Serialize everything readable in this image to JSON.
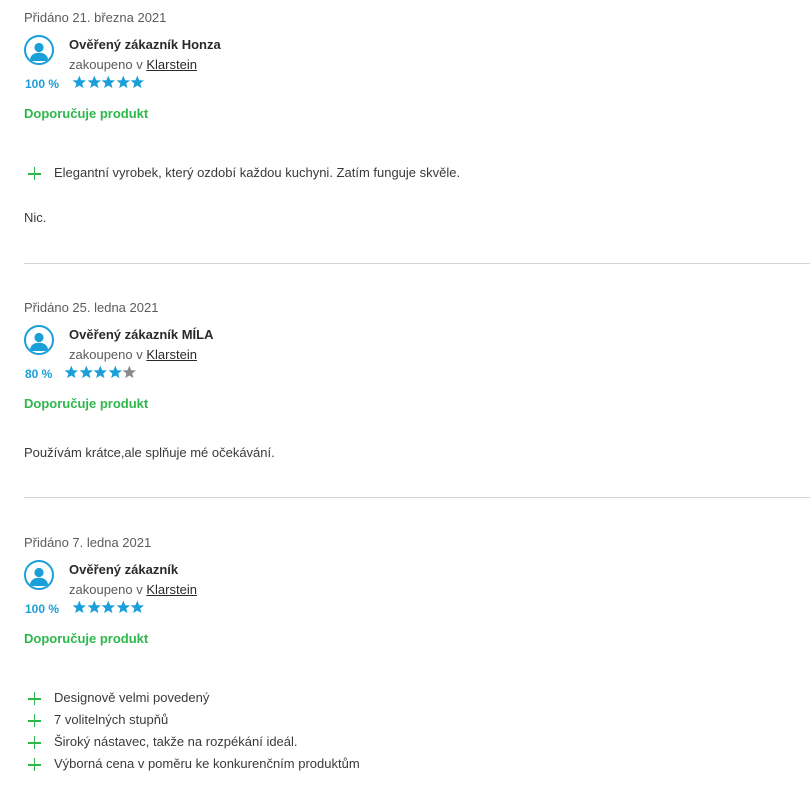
{
  "reviews": [
    {
      "date": "Přidáno 21. března 2021",
      "author": "Ověřený zákazník Honza",
      "purchased_prefix": "zakoupeno v",
      "store": "Klarstein",
      "rating_pct": "100 %",
      "stars_filled": 5,
      "recommend": "Doporučuje produkt",
      "pros": [
        "Elegantní vyrobek, který ozdobí každou kuchyni. Zatím funguje skvěle."
      ],
      "cons_text": "Nic."
    },
    {
      "date": "Přidáno 25. ledna 2021",
      "author": "Ověřený zákazník MÍLA",
      "purchased_prefix": "zakoupeno v",
      "store": "Klarstein",
      "rating_pct": "80 %",
      "stars_filled": 4,
      "recommend": "Doporučuje produkt",
      "comment": "Používám krátce,ale splňuje mé očekávání."
    },
    {
      "date": "Přidáno 7. ledna 2021",
      "author": "Ověřený zákazník",
      "purchased_prefix": "zakoupeno v",
      "store": "Klarstein",
      "rating_pct": "100 %",
      "stars_filled": 5,
      "recommend": "Doporučuje produkt",
      "pros": [
        "Designově velmi povedený",
        "7 volitelných stupňů",
        "Široký nástavec, takže na rozpékání ideál.",
        "Výborná cena v poměru ke konkurenčním produktům"
      ]
    }
  ],
  "colors": {
    "accent_blue": "#1a9fd9",
    "recommend_green": "#2db84b",
    "star_empty": "#8a8a8a",
    "divider": "#d4d4d4"
  },
  "icons": {
    "avatar": "user-avatar-icon",
    "star": "star-icon",
    "plus": "plus-icon"
  }
}
